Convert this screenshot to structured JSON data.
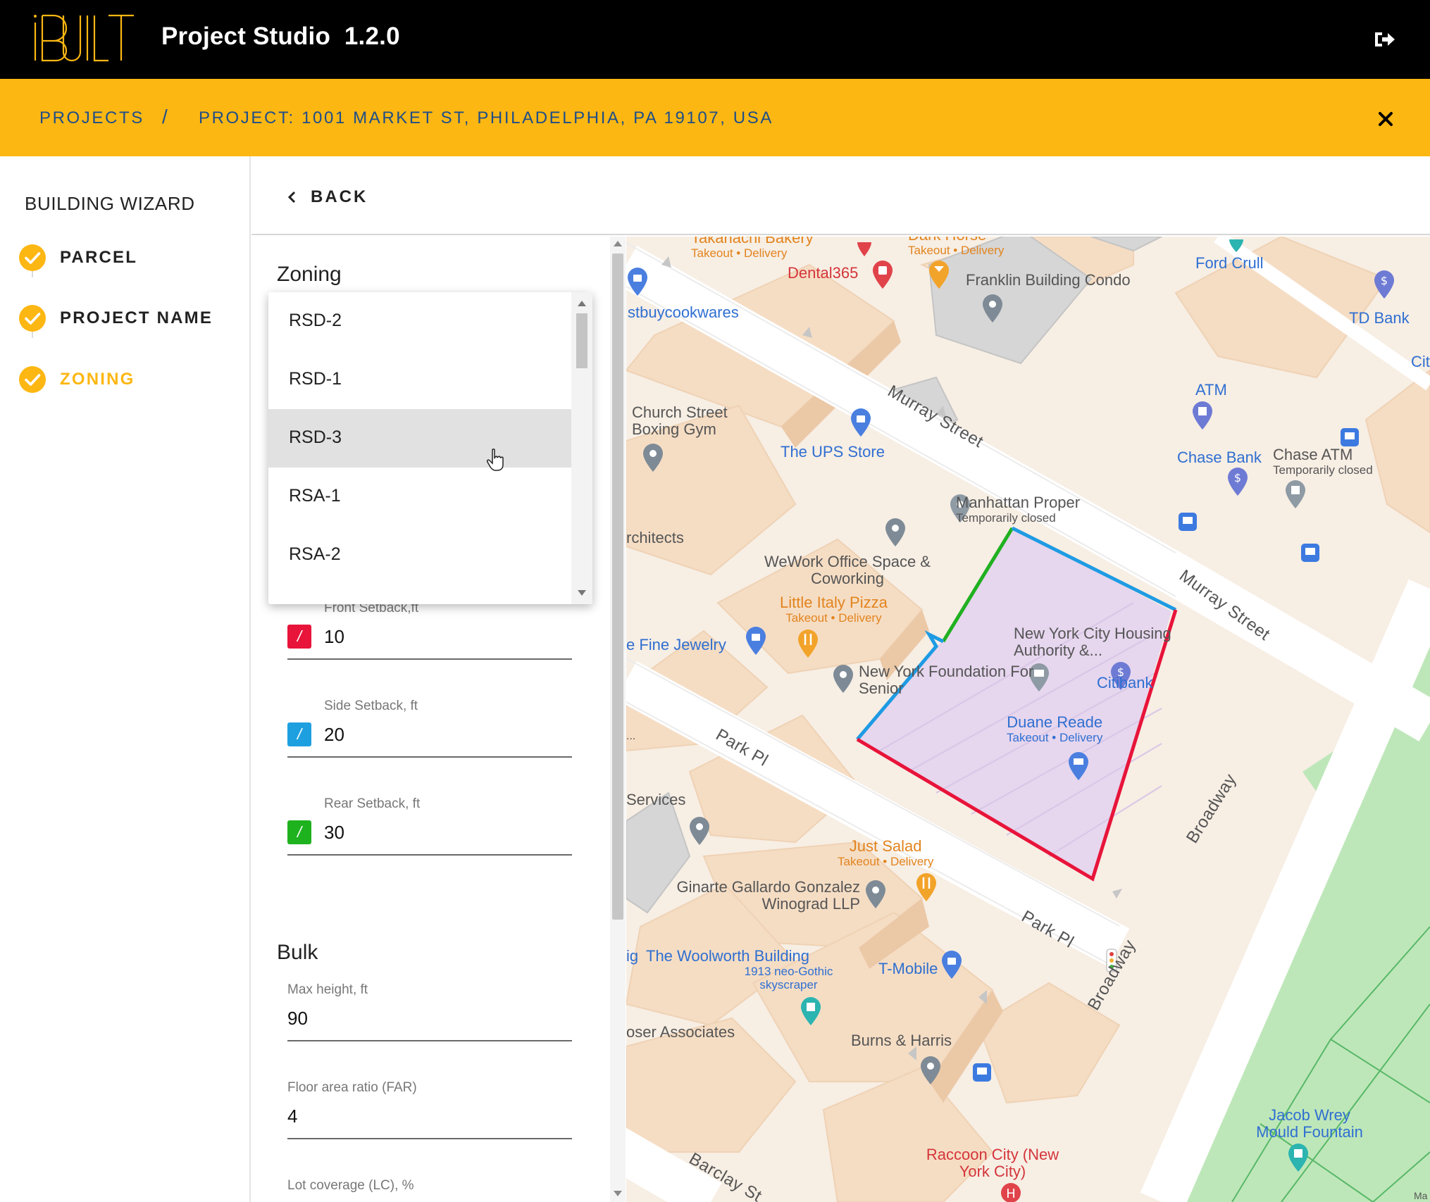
{
  "app": {
    "title": "Project Studio  1.2.0",
    "logo_text": "iBUILT",
    "brand_color": "#FDB713"
  },
  "breadcrumb": {
    "projects": "PROJECTS",
    "separator": "/",
    "project": "PROJECT: 1001 MARKET ST, PHILADELPHIA, PA 19107, USA"
  },
  "icons": {
    "logout": "logout-icon",
    "close": "close-icon",
    "back": "chevron-left-icon"
  },
  "wizard": {
    "title": "BUILDING WIZARD",
    "steps": [
      {
        "label": "PARCEL",
        "state": "done"
      },
      {
        "label": "PROJECT NAME",
        "state": "done"
      },
      {
        "label": "ZONING",
        "state": "active"
      }
    ]
  },
  "back": {
    "label": "BACK"
  },
  "zoning": {
    "title": "Zoning",
    "dropdown": {
      "options": [
        "RSD-2",
        "RSD-1",
        "RSD-3",
        "RSA-1",
        "RSA-2"
      ],
      "hovered": "RSD-3"
    },
    "setbacks": [
      {
        "label": "Front Setback,ft",
        "value": "10",
        "color": "#E8143A"
      },
      {
        "label": "Side Setback, ft",
        "value": "20",
        "color": "#1EA0E0"
      },
      {
        "label": "Rear Setback, ft",
        "value": "30",
        "color": "#1FB21F"
      }
    ]
  },
  "bulk": {
    "title": "Bulk",
    "fields": [
      {
        "label": "Max height, ft",
        "value": "90"
      },
      {
        "label": "Floor area ratio (FAR)",
        "value": "4"
      },
      {
        "label": "Lot coverage (LC), %",
        "value": ""
      }
    ]
  },
  "map": {
    "streets": [
      "Murray Street",
      "Murray Street",
      "Park Pl",
      "Park Pl",
      "Broadway",
      "Broadway",
      "Barclay St"
    ],
    "pois": {
      "takahachi": {
        "name": "Takahachi Bakery",
        "sub": "Takeout • Delivery"
      },
      "dark_horse": {
        "name": "Dark Horse",
        "sub": "Takeout • Delivery"
      },
      "dental365": {
        "name": "Dental365"
      },
      "franklin": {
        "name": "Franklin Building Condo"
      },
      "ford": {
        "name": "Ford Crull"
      },
      "tdbank": {
        "name": "TD Bank"
      },
      "cit": {
        "name": "Cit"
      },
      "bestbuy": {
        "name": "stbuycookwares"
      },
      "church": {
        "name": "Church Street Boxing Gym"
      },
      "ups": {
        "name": "The UPS Store"
      },
      "atm": {
        "name": "ATM"
      },
      "chase_bank": {
        "name": "Chase Bank"
      },
      "chase_atm": {
        "name": "Chase ATM",
        "sub": "Temporarily closed"
      },
      "manhattan": {
        "name": "Manhattan Proper",
        "sub": "Temporarily closed"
      },
      "architects": {
        "name": "rchitects"
      },
      "wework": {
        "name": "WeWork Office Space & Coworking"
      },
      "little_italy": {
        "name": "Little Italy Pizza",
        "sub": "Takeout • Delivery"
      },
      "fine_jewelry": {
        "name": "e Fine Jewelry"
      },
      "nych": {
        "name": "New York City Housing Authority &..."
      },
      "nyf": {
        "name": "New York Foundation For Senior"
      },
      "citibank": {
        "name": "Citibank"
      },
      "duane": {
        "name": "Duane Reade",
        "sub": "Takeout • Delivery"
      },
      "services": {
        "name": "Services"
      },
      "just_salad": {
        "name": "Just Salad",
        "sub": "Takeout • Delivery"
      },
      "ginarte": {
        "name": "Ginarte Gallardo Gonzalez Winograd LLP"
      },
      "woolworth": {
        "name": "The Woolworth Building",
        "sub": "1913 neo-Gothic skyscraper"
      },
      "tmobile": {
        "name": "T-Mobile"
      },
      "poser": {
        "name": "oser Associates"
      },
      "burns": {
        "name": "Burns & Harris"
      },
      "jacob": {
        "name": "Jacob Wrey Mould Fountain"
      },
      "raccoon": {
        "name": "Raccoon City (New York City)"
      },
      "ig": {
        "name": "ig"
      },
      "ma": {
        "name": "Ma"
      },
      "dots": {
        "name": "..."
      }
    }
  }
}
